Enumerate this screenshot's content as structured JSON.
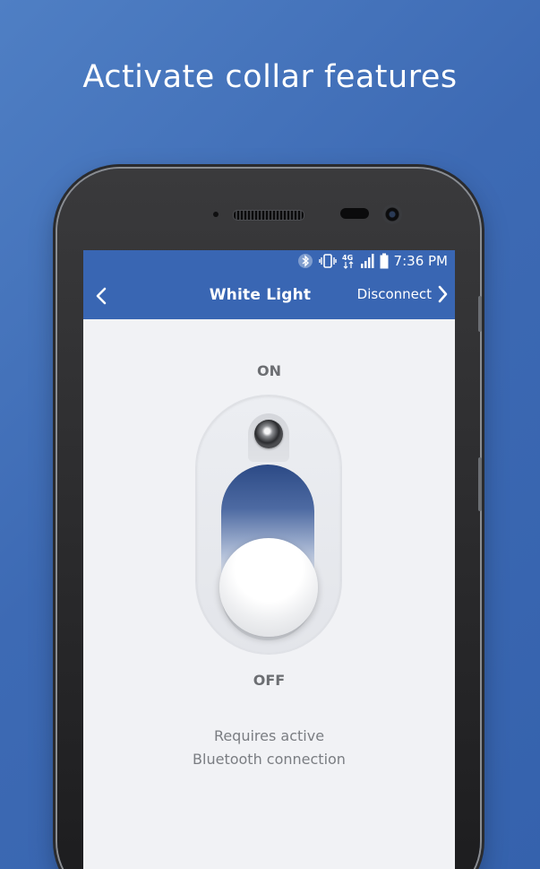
{
  "headline": "Activate collar features",
  "status_bar": {
    "time": "7:36 PM",
    "icons": [
      "bluetooth-icon",
      "vibrate-icon",
      "4g-icon",
      "signal-icon",
      "battery-icon"
    ]
  },
  "app_bar": {
    "title": "White Light",
    "disconnect_label": "Disconnect"
  },
  "switch": {
    "on_label": "ON",
    "off_label": "OFF",
    "state": "off",
    "fill_fraction": 0.62
  },
  "note": {
    "line1": "Requires active",
    "line2": "Bluetooth connection"
  },
  "colors": {
    "background": "#3d6ab4",
    "app_bar": "#3966b3",
    "content": "#f1f2f5",
    "slot_fill": "#2c4a86"
  }
}
